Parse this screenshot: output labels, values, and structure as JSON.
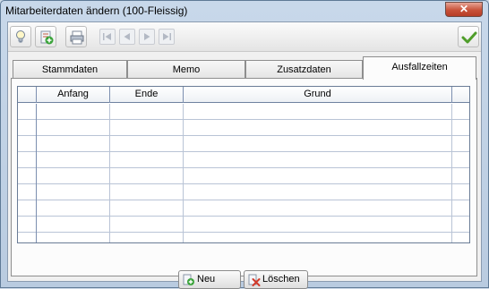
{
  "window": {
    "title": "Mitarbeiterdaten ändern (100-Fleissig)",
    "close_glyph": "✕"
  },
  "toolbar": {
    "icons": [
      "lightbulb-icon",
      "add-document-icon",
      "printer-icon",
      "first-record-icon",
      "previous-record-icon",
      "next-record-icon",
      "last-record-icon",
      "checkmark-icon"
    ]
  },
  "tabs": [
    {
      "label": "Stammdaten",
      "active": false
    },
    {
      "label": "Memo",
      "active": false
    },
    {
      "label": "Zusatzdaten",
      "active": false
    },
    {
      "label": "Ausfallzeiten",
      "active": true
    }
  ],
  "grid": {
    "columns": [
      "Anfang",
      "Ende",
      "Grund"
    ],
    "rows": [
      [],
      [],
      [],
      [],
      [],
      [],
      [],
      [],
      []
    ]
  },
  "buttons": {
    "new_label": "Neu",
    "delete_label": "Löschen"
  },
  "colors": {
    "add_green": "#3aa33a",
    "delete_red": "#d23a2a",
    "confirm_green": "#4f9d2a"
  }
}
